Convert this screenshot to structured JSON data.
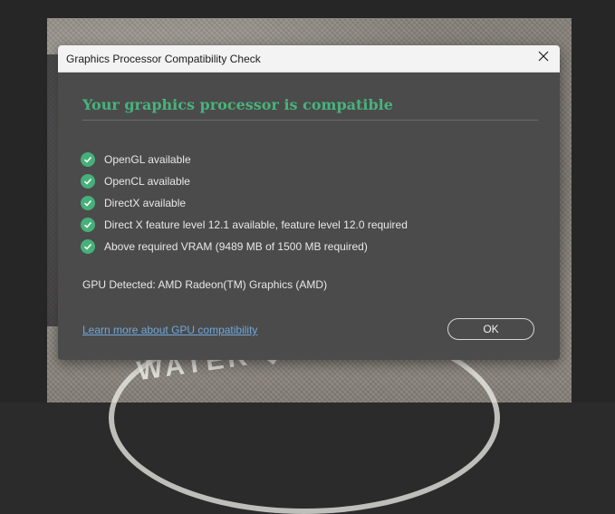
{
  "dialog": {
    "title": "Graphics Processor Compatibility Check",
    "header": "Your graphics processor is compatible",
    "checks": [
      {
        "label": "OpenGL available",
        "icon": "check-circle-icon"
      },
      {
        "label": "OpenCL available",
        "icon": "check-circle-icon"
      },
      {
        "label": "DirectX available",
        "icon": "check-circle-icon"
      },
      {
        "label": "Direct X feature level 12.1 available, feature level 12.0 required",
        "icon": "check-circle-icon"
      },
      {
        "label": "Above required VRAM (9489 MB of 1500 MB required)",
        "icon": "check-circle-icon"
      }
    ],
    "gpu_detected": "GPU Detected: AMD Radeon(TM) Graphics (AMD)",
    "learn_more_link": "Learn more about GPU compatibility",
    "ok_label": "OK",
    "close_icon": "close-icon"
  },
  "colors": {
    "accent_green": "#48b27c",
    "link_blue": "#6fa8dc",
    "dialog_bg": "#4b4b4b",
    "titlebar_bg": "#f3f3f3"
  }
}
